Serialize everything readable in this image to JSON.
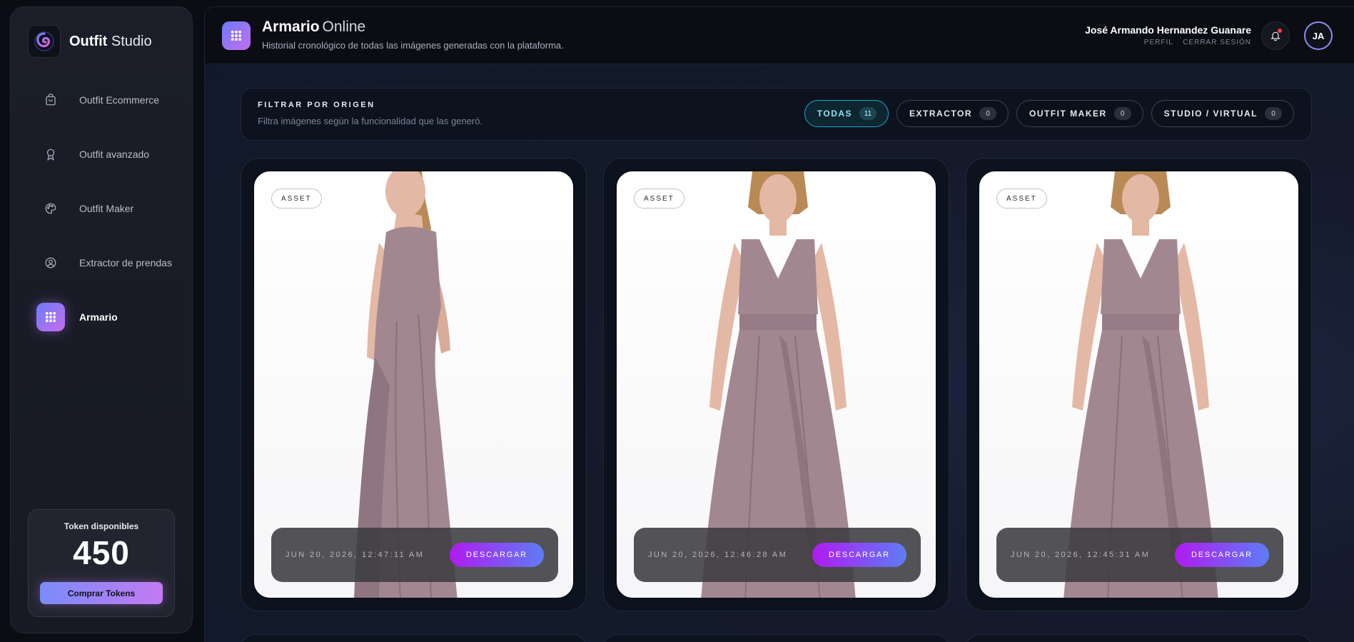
{
  "brand": {
    "name_bold": "Outfit",
    "name_light": "Studio"
  },
  "nav": [
    {
      "label": "Outfit Ecommerce",
      "icon": "shopping-bag-icon",
      "active": false
    },
    {
      "label": "Outfit avanzado",
      "icon": "award-icon",
      "active": false
    },
    {
      "label": "Outfit Maker",
      "icon": "palette-icon",
      "active": false
    },
    {
      "label": "Extractor de prendas",
      "icon": "user-circle-icon",
      "active": false
    },
    {
      "label": "Armario",
      "icon": "grid-icon",
      "active": true
    }
  ],
  "tokens": {
    "title": "Token disponibles",
    "value": "450",
    "button": "Comprar Tokens"
  },
  "header": {
    "title": "Armario",
    "title_suffix": "Online",
    "subtitle": "Historial cronológico de todas las imágenes generadas con la plataforma.",
    "user_name": "José Armando Hernandez Guanare",
    "profile_link": "PERFIL",
    "logout_link": "CERRAR SESIÓN",
    "avatar_initials": "JA"
  },
  "filter": {
    "title": "FILTRAR POR ORIGEN",
    "description": "Filtra imágenes según la funcionalidad que las generó.",
    "chips": [
      {
        "label": "TODAS",
        "count": "11",
        "active": true
      },
      {
        "label": "EXTRACTOR",
        "count": "0",
        "active": false
      },
      {
        "label": "OUTFIT MAKER",
        "count": "0",
        "active": false
      },
      {
        "label": "STUDIO / VIRTUAL",
        "count": "0",
        "active": false
      }
    ]
  },
  "gallery": [
    {
      "tag": "ASSET",
      "date": "JUN 20, 2026, 12:47:11 AM",
      "button": "DESCARGAR",
      "pose": "back"
    },
    {
      "tag": "ASSET",
      "date": "JUN 20, 2026, 12:46:28 AM",
      "button": "DESCARGAR",
      "pose": "front"
    },
    {
      "tag": "ASSET",
      "date": "JUN 20, 2026, 12:45:31 AM",
      "button": "DESCARGAR",
      "pose": "front"
    }
  ],
  "colors": {
    "dress": "#a28791",
    "skin": "#e3b8a4",
    "hair": "#b98a55",
    "accent": "#c46ef0"
  }
}
